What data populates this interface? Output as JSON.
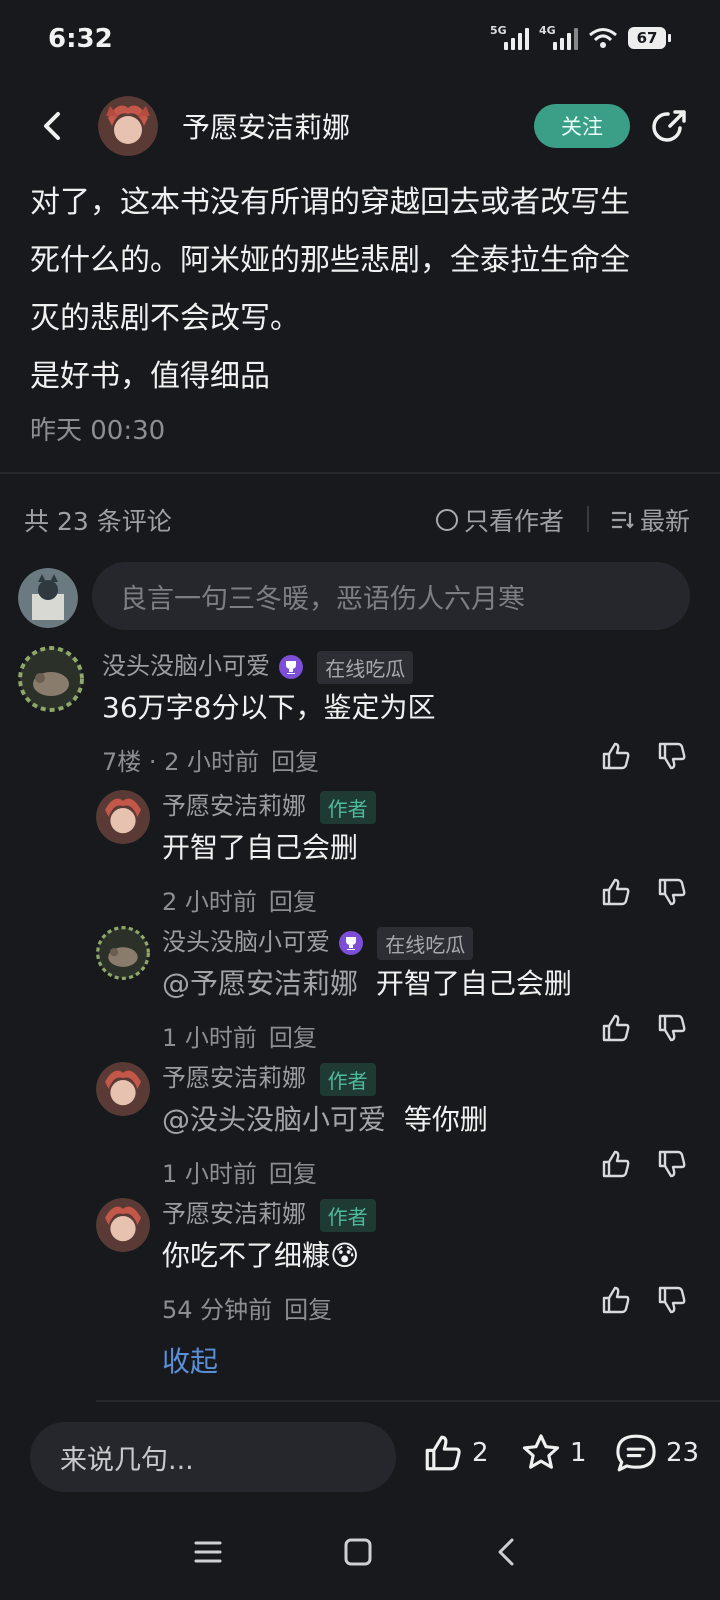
{
  "status_bar": {
    "time": "6:32",
    "signal1": "5G",
    "signal2": "4G",
    "battery": "67"
  },
  "header": {
    "author_name": "予愿安洁莉娜",
    "follow_label": "关注"
  },
  "post": {
    "lines": [
      "对了，这本书没有所谓的穿越回去或者改写生",
      "死什么的。阿米娅的那些悲剧，全泰拉生命全",
      "灭的悲剧不会改写。",
      "是好书，值得细品"
    ],
    "time": "昨天 00:30"
  },
  "comments_bar": {
    "count": "共 23 条评论",
    "author_only": "只看作者",
    "latest": "最新"
  },
  "comment_input": {
    "placeholder": "良言一句三冬暖，恶语伤人六月寒"
  },
  "comments": [
    {
      "name": "没头没脑小可爱",
      "tag": "在线吃瓜",
      "text": "36万字8分以下，鉴定为区",
      "meta": "7楼 · 2 小时前",
      "reply": "回复"
    },
    {
      "name": "予愿安洁莉娜",
      "tag": "作者",
      "text": "开智了自己会删",
      "meta": "2 小时前",
      "reply": "回复"
    },
    {
      "name": "没头没脑小可爱",
      "tag": "在线吃瓜",
      "at": "@予愿安洁莉娜",
      "text": "开智了自己会删",
      "meta": "1 小时前",
      "reply": "回复"
    },
    {
      "name": "予愿安洁莉娜",
      "tag": "作者",
      "at": "@没头没脑小可爱",
      "text": "等你删",
      "meta": "1 小时前",
      "reply": "回复"
    },
    {
      "name": "予愿安洁莉娜",
      "tag": "作者",
      "text": "你吃不了细糠😰",
      "meta": "54 分钟前",
      "reply": "回复"
    }
  ],
  "collapse_label": "收起",
  "bottom_bar": {
    "say_placeholder": "来说几句...",
    "likes": "2",
    "favorites": "1",
    "comments": "23"
  },
  "colors": {
    "background": "#18191d",
    "accent": "#3a9f86",
    "link": "#5a8fd8"
  },
  "icons": [
    "back-icon",
    "share-icon",
    "like-icon",
    "dislike-icon",
    "star-icon",
    "comment-icon",
    "trophy-icon",
    "menu-icon",
    "home-icon",
    "nav-back-icon"
  ]
}
